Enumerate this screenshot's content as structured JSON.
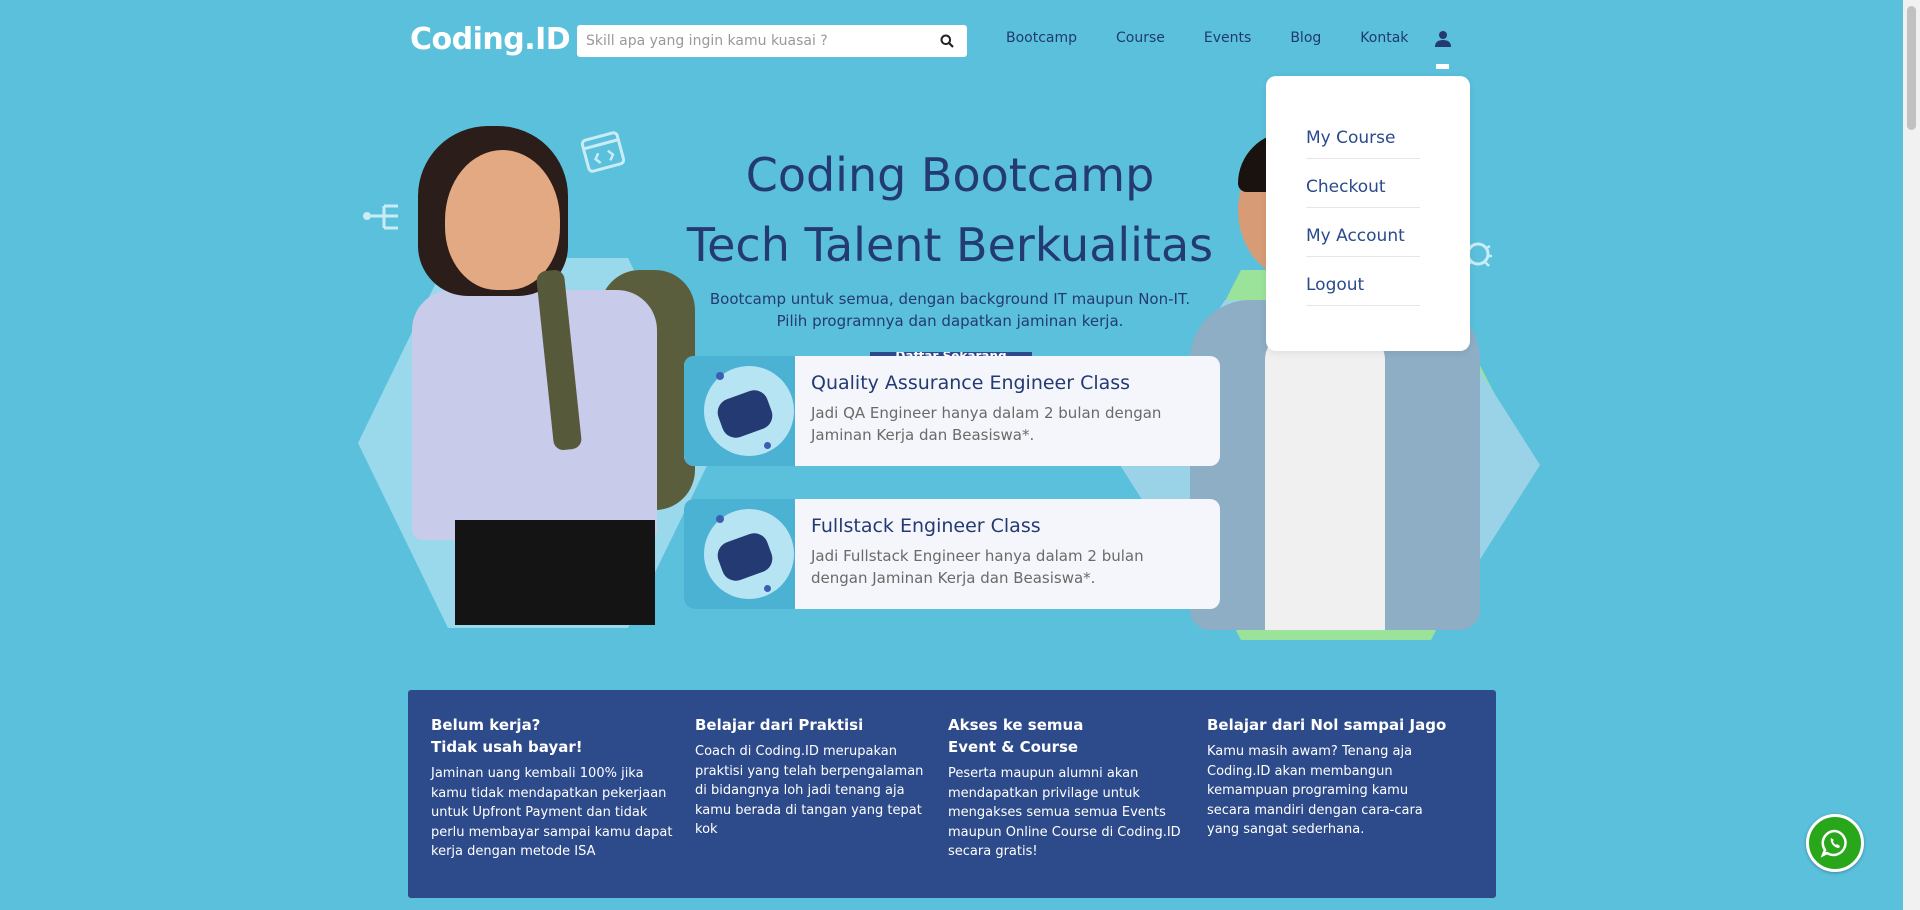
{
  "header": {
    "logo": "Coding.ID",
    "search_placeholder": "Skill apa yang ingin kamu kuasai ?",
    "nav": [
      "Bootcamp",
      "Course",
      "Events",
      "Blog",
      "Kontak"
    ]
  },
  "dropdown": {
    "items": [
      "My Course",
      "Checkout",
      "My Account",
      "Logout"
    ]
  },
  "hero": {
    "title_line1": "Coding Bootcamp",
    "title_line2": "Tech Talent Berkualitas",
    "subtitle_line1": "Bootcamp untuk semua, dengan background IT maupun Non-IT.",
    "subtitle_line2": "Pilih programnya dan dapatkan jaminan kerja.",
    "cta_partial": "Daftar Sekarang"
  },
  "classes": [
    {
      "title": "Quality Assurance Engineer Class",
      "description": "Jadi QA Engineer hanya dalam 2 bulan dengan Jaminan Kerja dan Beasiswa*."
    },
    {
      "title": "Fullstack Engineer Class",
      "description": "Jadi Fullstack Engineer hanya dalam 2 bulan dengan Jaminan Kerja dan Beasiswa*."
    }
  ],
  "features": [
    {
      "title": "Belum kerja?\nTidak usah bayar!",
      "description": "Jaminan uang kembali 100% jika kamu tidak mendapatkan pekerjaan untuk Upfront Payment dan tidak perlu membayar sampai kamu dapat kerja dengan metode ISA"
    },
    {
      "title": "Belajar dari Praktisi",
      "description": "Coach di Coding.ID merupakan praktisi yang telah berpengalaman di bidangnya loh jadi tenang aja kamu berada di tangan yang tepat kok"
    },
    {
      "title": "Akses ke semua\nEvent & Course",
      "description": "Peserta maupun alumni akan mendapatkan privilage untuk mengakses semua semua Events maupun Online Course di Coding.ID secara gratis!"
    },
    {
      "title": "Belajar dari Nol sampai Jago",
      "description": "Kamu masih awam? Tenang aja Coding.ID akan membangun kemampuan programing kamu secara mandiri dengan cara-cara yang sangat sederhana."
    }
  ],
  "colors": {
    "background": "#5bc0dc",
    "primary_dark": "#243a73",
    "features_bg": "#2d4a8a",
    "whatsapp": "#29a71a"
  },
  "icons": [
    "search-icon",
    "user-icon",
    "whatsapp-icon",
    "code-window-icon",
    "network-icon",
    "bug-icon",
    "robot-icon"
  ]
}
